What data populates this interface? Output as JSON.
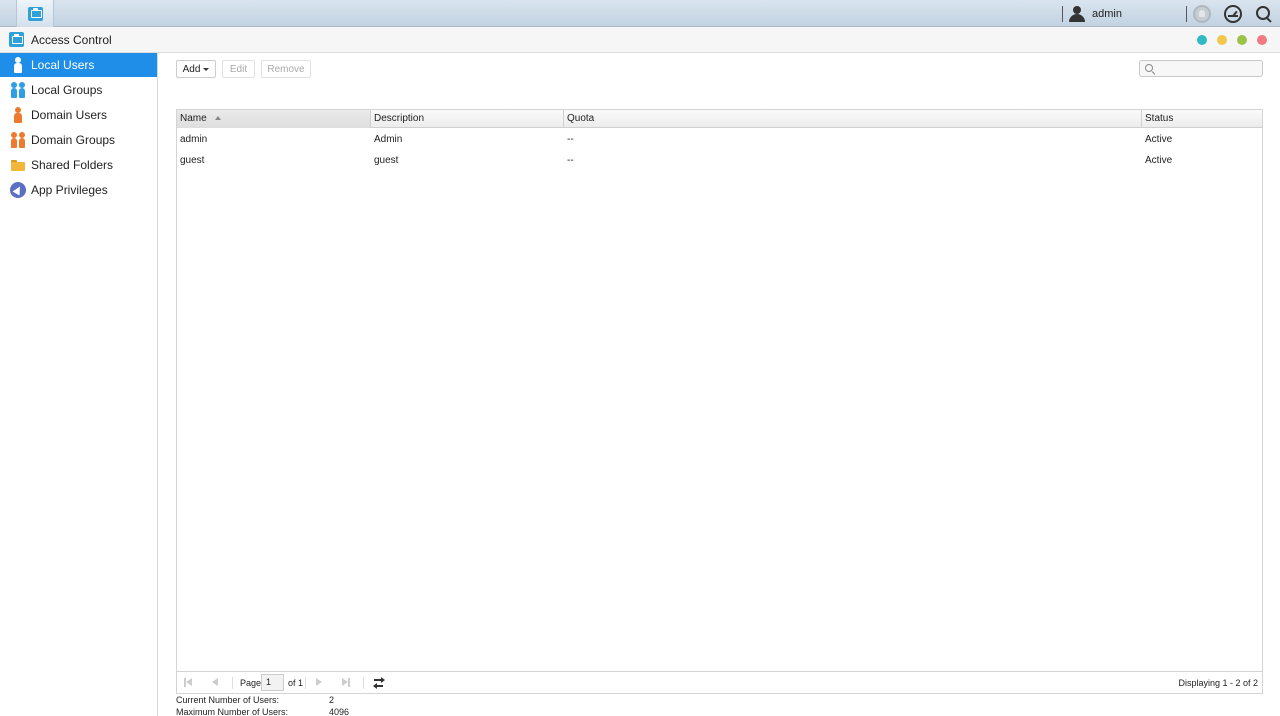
{
  "taskbar": {
    "username": "admin"
  },
  "window": {
    "title": "Access Control"
  },
  "sidebar": {
    "items": [
      {
        "label": "Local Users",
        "icon": "user-icon",
        "active": true
      },
      {
        "label": "Local Groups",
        "icon": "group-icon"
      },
      {
        "label": "Domain Users",
        "icon": "domain-user-icon"
      },
      {
        "label": "Domain Groups",
        "icon": "domain-group-icon"
      },
      {
        "label": "Shared Folders",
        "icon": "folder-icon"
      },
      {
        "label": "App Privileges",
        "icon": "app-privileges-icon"
      }
    ]
  },
  "toolbar": {
    "add_label": "Add",
    "edit_label": "Edit",
    "remove_label": "Remove",
    "search_placeholder": ""
  },
  "table": {
    "columns": [
      "Name",
      "Description",
      "Quota",
      "Status"
    ],
    "rows": [
      {
        "name": "admin",
        "description": "Admin",
        "quota": "--",
        "status": "Active"
      },
      {
        "name": "guest",
        "description": "guest",
        "quota": "--",
        "status": "Active"
      }
    ]
  },
  "pager": {
    "page_label": "Page",
    "page_value": "1",
    "of_label": "of 1",
    "display_text": "Displaying 1 - 2 of 2"
  },
  "stats": {
    "current_label": "Current Number of Users:",
    "current_value": "2",
    "max_label": "Maximum Number of Users:",
    "max_value": "4096"
  },
  "colors": {
    "accent": "#1e8ee9",
    "window_teal": "#32b9c4",
    "window_yellow": "#f2c74a",
    "window_green": "#9ac447",
    "window_red": "#ef7a82"
  }
}
